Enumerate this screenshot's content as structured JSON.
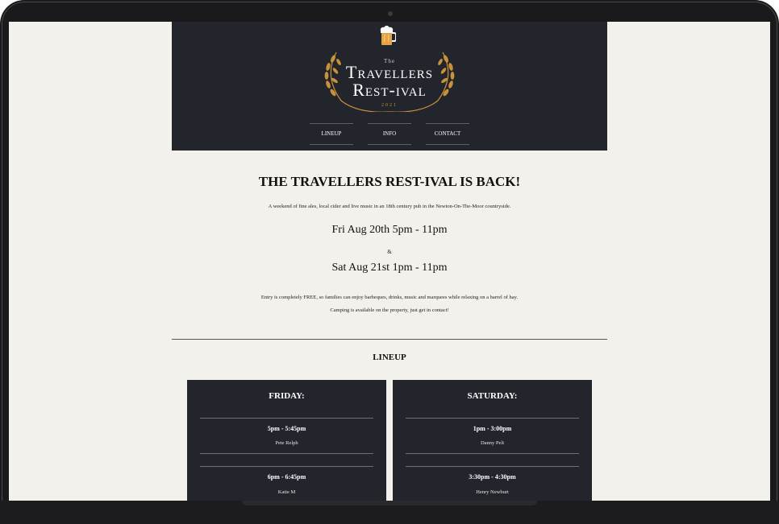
{
  "header": {
    "logo": {
      "the": "The",
      "line1": "Travellers",
      "line2": "Rest-ival",
      "year": "2021"
    },
    "nav": [
      {
        "label": "LINEUP"
      },
      {
        "label": "INFO"
      },
      {
        "label": "CONTACT"
      }
    ]
  },
  "intro": {
    "heading": "THE TRAVELLERS REST-IVAL IS BACK!",
    "description": "A weekend of fine ales, local cider and live music in an 18th century pub in the Newton-On-The-Moor countryside.",
    "date1": "Fri Aug 20th 5pm - 11pm",
    "amp": "&",
    "date2": "Sat Aug 21st 1pm - 11pm",
    "entry": "Entry is completely FREE, so families can enjoy barbeques, drinks, music and marquees while relaxing on a barrel of hay.",
    "camping": "Camping is available on the property, just get in contact!"
  },
  "lineup": {
    "title": "LINEUP",
    "days": [
      {
        "title": "FRIDAY:",
        "slots": [
          {
            "time": "5pm - 5:45pm",
            "act": "Pete Relph"
          },
          {
            "time": "6pm - 6:45pm",
            "act": "Katie M"
          }
        ]
      },
      {
        "title": "SATURDAY:",
        "slots": [
          {
            "time": "1pm - 3:00pm",
            "act": "Danny Pelt"
          },
          {
            "time": "3:30pm - 4:30pm",
            "act": "Henry Newburt"
          }
        ]
      }
    ]
  },
  "colors": {
    "header_bg": "#22252c",
    "page_bg": "#f3f1ec",
    "accent_gold": "#c8913a"
  }
}
